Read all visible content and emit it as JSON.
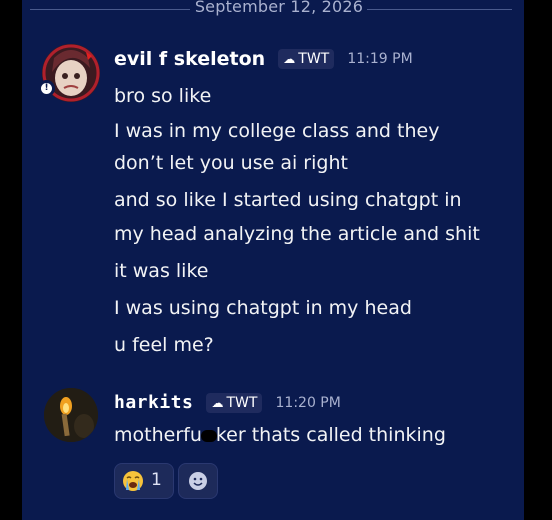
{
  "date_divider": "September 12, 2026",
  "messages": [
    {
      "username": "evil f skeleton",
      "tag": "TWT",
      "time": "11:19 PM",
      "lines": [
        "bro so like",
        "I was in my college class and they",
        "don’t let you use ai right",
        "and so like I started using chatgpt in",
        "my head analyzing the article and shit",
        "it was like",
        "I was using chatgpt in my head",
        "u feel me?"
      ]
    },
    {
      "username": "harkits",
      "tag": "TWT",
      "time": "11:20 PM",
      "text_before": "motherfu",
      "text_after": "ker thats called thinking"
    }
  ],
  "reactions": [
    {
      "emoji": "loudly-crying-face-icon",
      "count": "1"
    },
    {
      "emoji": "add-reaction-icon"
    }
  ],
  "colors": {
    "background": "#0a1a4e",
    "outer": "#000000",
    "text": "#f2f3f5",
    "muted": "#a9b1cf",
    "tag_bg": "#1f2b5e"
  }
}
